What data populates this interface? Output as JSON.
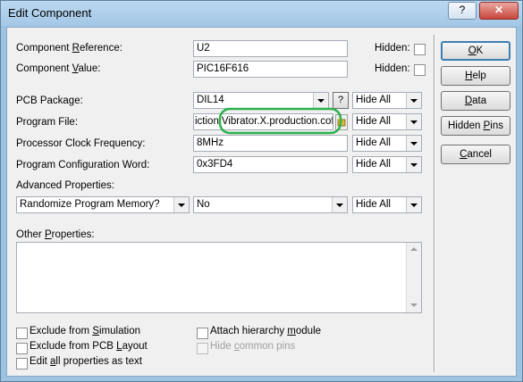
{
  "window": {
    "title": "Edit Component",
    "help_glyph": "?",
    "close_glyph": "✕"
  },
  "fields": {
    "component_reference": {
      "label_pre": "Component ",
      "label_u": "R",
      "label_post": "eference:",
      "value": "U2",
      "hidden_label": "Hidden:"
    },
    "component_value": {
      "label_pre": "Component ",
      "label_u": "V",
      "label_post": "alue:",
      "value": "PIC16F616",
      "hidden_label": "Hidden:"
    },
    "pcb_package": {
      "label": "PCB Package:",
      "value": "DIL14",
      "help_button": "?",
      "visibility": "Hide All"
    },
    "program_file": {
      "label": "Program File:",
      "value_prefix": "iction",
      "value_visible": "Vibrator.X.production.cof",
      "visibility": "Hide All"
    },
    "processor_clock": {
      "label": "Processor Clock Frequency:",
      "value": "8MHz",
      "visibility": "Hide All"
    },
    "program_config": {
      "label": "Program Configuration Word:",
      "value": "0x3FD4",
      "visibility": "Hide All"
    },
    "advanced": {
      "label": "Advanced Properties:",
      "property": "Randomize Program Memory?",
      "value": "No",
      "visibility": "Hide All"
    },
    "other_properties": {
      "label_pre": "Other ",
      "label_u": "P",
      "label_post": "roperties:",
      "value": ""
    }
  },
  "options": {
    "exclude_simulation": {
      "pre": "Exclude from ",
      "u": "S",
      "post": "imulation"
    },
    "exclude_pcb": {
      "pre": "Exclude from PCB ",
      "u": "L",
      "post": "ayout"
    },
    "edit_all": {
      "pre": "Edit ",
      "u": "a",
      "post": "ll properties as text"
    },
    "attach_hierarchy": {
      "pre": "Attach hierarchy ",
      "u": "m",
      "post": "odule"
    },
    "hide_common_pins": {
      "pre": "Hide ",
      "u": "c",
      "post": "ommon pins"
    }
  },
  "buttons": {
    "ok": {
      "u": "O",
      "post": "K"
    },
    "help": {
      "u": "H",
      "post": "elp"
    },
    "data": {
      "u": "D",
      "post": "ata"
    },
    "hidden_pins": {
      "pre": "Hidden ",
      "u": "P",
      "post": "ins"
    },
    "cancel": {
      "u": "C",
      "post": "ancel"
    }
  },
  "colors": {
    "highlight_circle": "#2bb24c",
    "default_button_border": "#3c7fb1"
  }
}
